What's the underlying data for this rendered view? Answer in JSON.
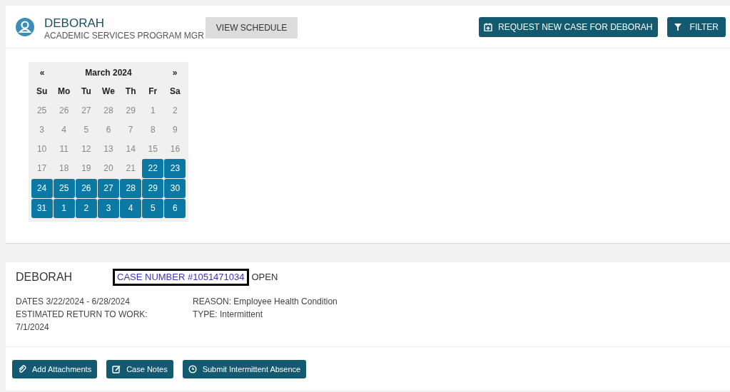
{
  "header": {
    "name": "DEBORAH",
    "role": "ACADEMIC SERVICES PROGRAM MGR",
    "view_schedule": "VIEW SCHEDULE",
    "request_button": "REQUEST NEW CASE FOR DEBORAH",
    "filter_button": "FILTER"
  },
  "calendar": {
    "prev": "«",
    "title": "March 2024",
    "next": "»",
    "weekdays": [
      "Su",
      "Mo",
      "Tu",
      "We",
      "Th",
      "Fr",
      "Sa"
    ],
    "weeks": [
      [
        {
          "day": "25",
          "selected": false
        },
        {
          "day": "26",
          "selected": false
        },
        {
          "day": "27",
          "selected": false
        },
        {
          "day": "28",
          "selected": false
        },
        {
          "day": "29",
          "selected": false
        },
        {
          "day": "1",
          "selected": false
        },
        {
          "day": "2",
          "selected": false
        }
      ],
      [
        {
          "day": "3",
          "selected": false
        },
        {
          "day": "4",
          "selected": false
        },
        {
          "day": "5",
          "selected": false
        },
        {
          "day": "6",
          "selected": false
        },
        {
          "day": "7",
          "selected": false
        },
        {
          "day": "8",
          "selected": false
        },
        {
          "day": "9",
          "selected": false
        }
      ],
      [
        {
          "day": "10",
          "selected": false
        },
        {
          "day": "11",
          "selected": false
        },
        {
          "day": "12",
          "selected": false
        },
        {
          "day": "13",
          "selected": false
        },
        {
          "day": "14",
          "selected": false
        },
        {
          "day": "15",
          "selected": false
        },
        {
          "day": "16",
          "selected": false
        }
      ],
      [
        {
          "day": "17",
          "selected": false
        },
        {
          "day": "18",
          "selected": false
        },
        {
          "day": "19",
          "selected": false
        },
        {
          "day": "20",
          "selected": false
        },
        {
          "day": "21",
          "selected": false
        },
        {
          "day": "22",
          "selected": true
        },
        {
          "day": "23",
          "selected": true
        }
      ],
      [
        {
          "day": "24",
          "selected": true
        },
        {
          "day": "25",
          "selected": true
        },
        {
          "day": "26",
          "selected": true
        },
        {
          "day": "27",
          "selected": true
        },
        {
          "day": "28",
          "selected": true
        },
        {
          "day": "29",
          "selected": true
        },
        {
          "day": "30",
          "selected": true
        }
      ],
      [
        {
          "day": "31",
          "selected": true
        },
        {
          "day": "1",
          "selected": true
        },
        {
          "day": "2",
          "selected": true
        },
        {
          "day": "3",
          "selected": true
        },
        {
          "day": "4",
          "selected": true
        },
        {
          "day": "5",
          "selected": true
        },
        {
          "day": "6",
          "selected": true
        }
      ]
    ]
  },
  "case": {
    "name": "DEBORAH",
    "case_number": "CASE NUMBER #1051471034",
    "status": "OPEN",
    "dates": "DATES 3/22/2024 - 6/28/2024",
    "return_label": "ESTIMATED RETURN TO WORK:",
    "return_date": "7/1/2024",
    "reason": "REASON: Employee Health Condition",
    "type": "TYPE: Intermittent",
    "actions": [
      {
        "kind": "attach",
        "label": "Add Attachments"
      },
      {
        "kind": "notes",
        "label": "Case Notes"
      },
      {
        "kind": "clock",
        "label": "Submit Intermittent Absence"
      }
    ]
  }
}
